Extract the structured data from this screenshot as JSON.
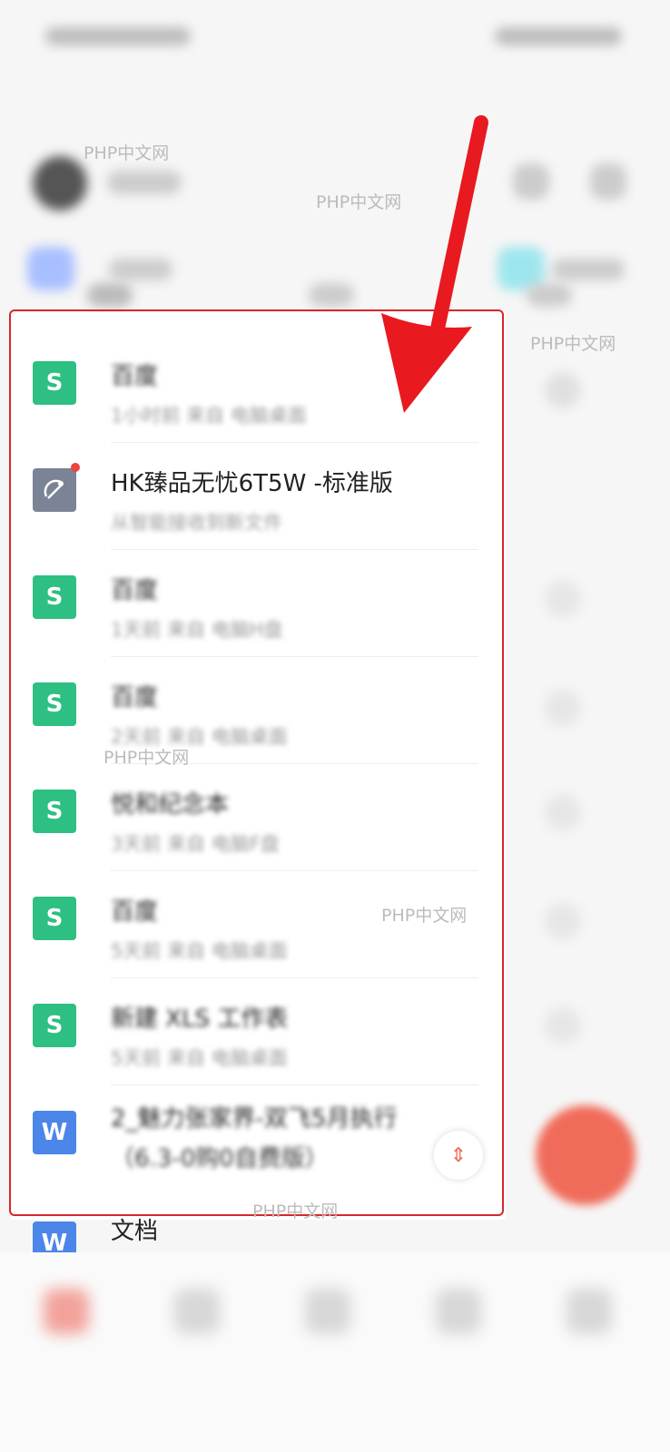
{
  "watermark_text": "PHP中文网",
  "list": {
    "items": [
      {
        "icon": "S",
        "type": "sheet",
        "title": "百度",
        "sub": "1小时前  来自 电脑桌面"
      },
      {
        "icon": "device",
        "type": "device",
        "title": "HK臻品无忧6T5W -标准版",
        "sub": "从智能接收到新文件"
      },
      {
        "icon": "S",
        "type": "sheet",
        "title": "百度",
        "sub": "1天前  来自 电脑H盘"
      },
      {
        "icon": "S",
        "type": "sheet",
        "title": "百度",
        "sub": "2天前  来自 电脑桌面"
      },
      {
        "icon": "S",
        "type": "sheet",
        "title": "悦和纪念本",
        "sub": "3天前  来自 电脑F盘"
      },
      {
        "icon": "S",
        "type": "sheet",
        "title": "百度",
        "sub": "5天前  来自 电脑桌面"
      },
      {
        "icon": "S",
        "type": "sheet",
        "title": "新建 XLS 工作表",
        "sub": "5天前  来自 电脑桌面"
      },
      {
        "icon": "W",
        "type": "doc",
        "title": "2_魅力张家界-双飞5月执行",
        "sub": "（6.3-0购0自费版）"
      }
    ]
  },
  "outside_item": {
    "icon": "W",
    "title": "文档"
  },
  "scroll_handle": {
    "glyph": "⇕"
  },
  "colors": {
    "sheet": "#2ebf82",
    "doc": "#4b86e8",
    "annotation": "#d8272c",
    "fab": "#f06b5a"
  }
}
